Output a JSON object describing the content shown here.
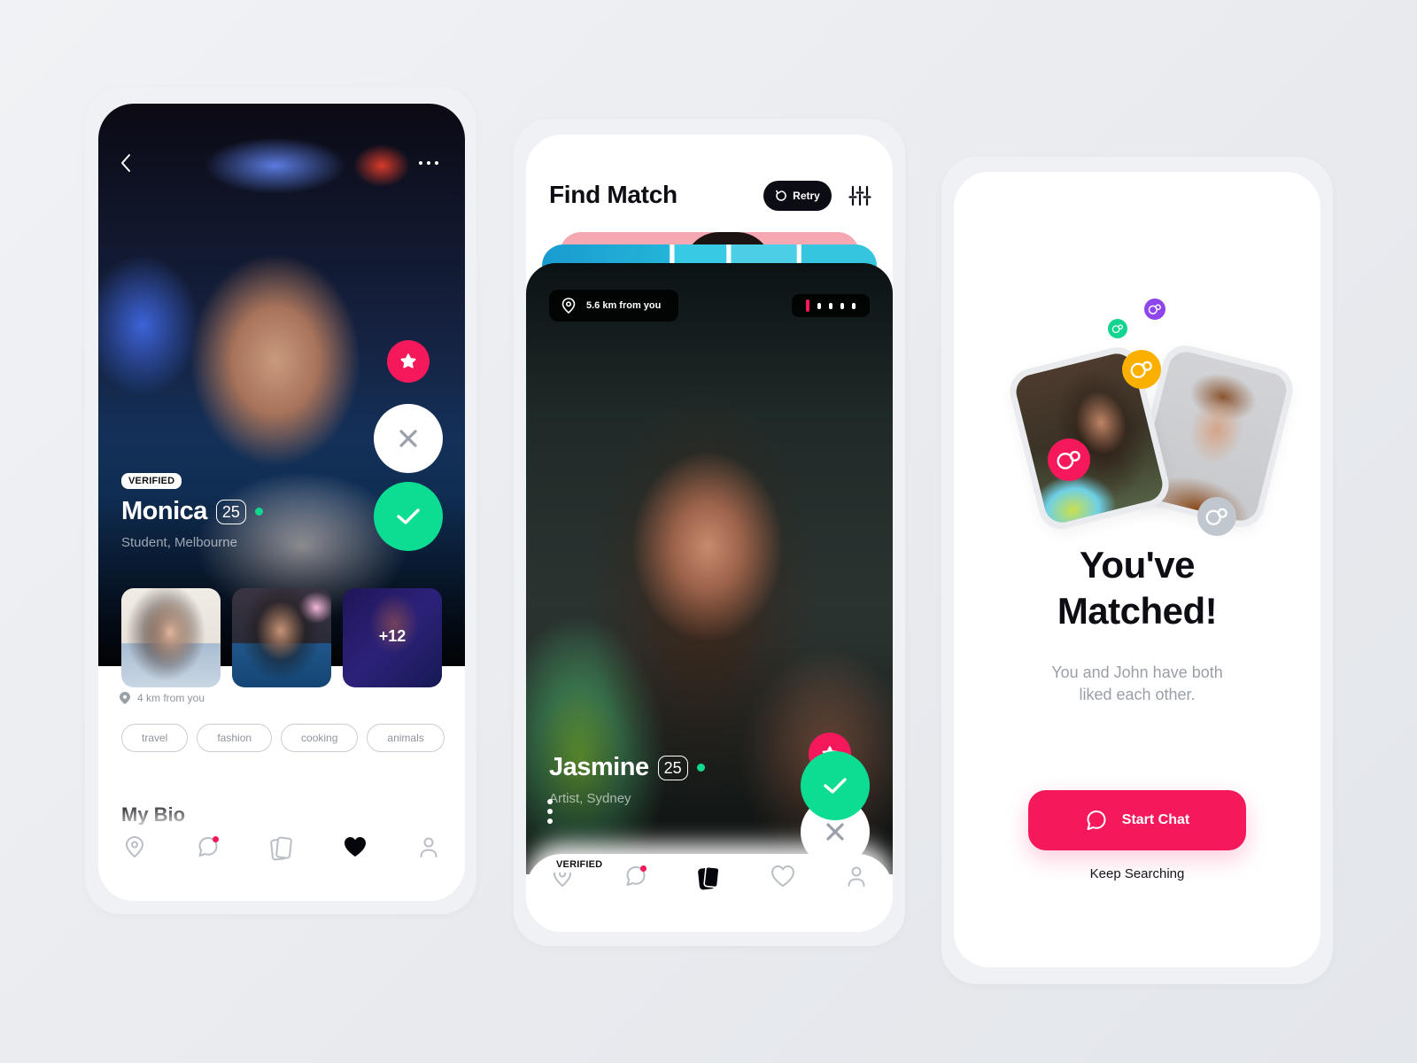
{
  "colors": {
    "accent_pink": "#f5195b",
    "accent_green": "#0ddd93",
    "online_green": "#10d98f",
    "dark": "#0c0c14",
    "muted_text": "#8f949c",
    "bubble_purple": "#8e45e9",
    "bubble_yellow": "#fbb000",
    "bubble_gray": "#c1c7ce"
  },
  "profile_screen": {
    "back_icon": "chevron-left-icon",
    "menu_icon": "more-horizontal-icon",
    "verified_label": "VERIFIED",
    "name": "Monica",
    "age": "25",
    "online": true,
    "subtitle": "Student, Melbourne",
    "actions": [
      {
        "name": "super-like",
        "icon": "star-icon"
      },
      {
        "name": "dislike",
        "icon": "close-icon"
      },
      {
        "name": "like",
        "icon": "check-icon"
      }
    ],
    "photos": {
      "count_shown": 3,
      "more_label": "+12"
    },
    "distance": "4 km from you",
    "interests": [
      "travel",
      "fashion",
      "cooking",
      "animals"
    ],
    "bio_title": "My Bio"
  },
  "find_match_screen": {
    "title": "Find Match",
    "retry_label": "Retry",
    "filter_icon": "sliders-icon",
    "distance": "5.6 km from you",
    "photo_pager": {
      "total": 5,
      "active_index": 0
    },
    "verified_label": "VERIFIED",
    "name": "Jasmine",
    "age": "25",
    "online": true,
    "subtitle": "Artist, Sydney",
    "actions": [
      {
        "name": "super-like",
        "icon": "star-icon"
      },
      {
        "name": "dislike",
        "icon": "close-icon"
      },
      {
        "name": "like",
        "icon": "check-icon"
      }
    ]
  },
  "match_screen": {
    "title_line1": "You've",
    "title_line2": "Matched!",
    "subtitle_line1": "You and John have both",
    "subtitle_line2": "liked each other.",
    "primary_button": "Start Chat",
    "secondary_link": "Keep Searching"
  },
  "bottom_nav": {
    "items": [
      {
        "name": "location",
        "icon": "map-pin-icon"
      },
      {
        "name": "messages",
        "icon": "chat-bubble-icon",
        "has_notification": true
      },
      {
        "name": "cards",
        "icon": "cards-icon"
      },
      {
        "name": "likes",
        "icon": "heart-icon"
      },
      {
        "name": "profile",
        "icon": "user-icon"
      }
    ],
    "profile_screen_active": "likes",
    "find_match_screen_active": "cards"
  }
}
